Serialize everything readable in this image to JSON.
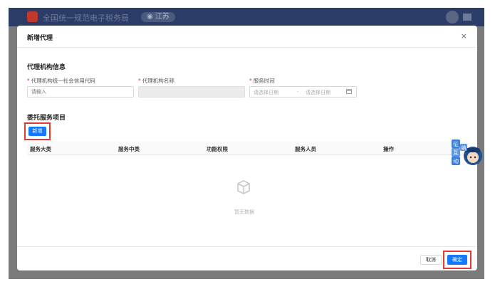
{
  "app": {
    "title": "全国统一规范电子税务局",
    "region": "江苏"
  },
  "modal": {
    "title": "新增代理",
    "close_glyph": "×",
    "agency_section_title": "代理机构信息",
    "fields": {
      "credit_code": {
        "label": "代理机构统一社会信用代码",
        "placeholder": "请输入",
        "value": ""
      },
      "agency_name": {
        "label": "代理机构名称",
        "value": ""
      },
      "service_time": {
        "label": "服务时间",
        "start_placeholder": "请选择日期",
        "separator": "-",
        "end_placeholder": "请选择日期"
      }
    },
    "service_section_title": "委托服务项目",
    "add_label": "新增",
    "table": {
      "columns": [
        "服务大类",
        "服务中类",
        "功能权限",
        "服务人员",
        "操作"
      ],
      "rows": [],
      "empty_text": "暂无数据"
    },
    "cancel_label": "取消",
    "ok_label": "确定"
  },
  "mascot": {
    "chars": [
      "征",
      "纳",
      "互",
      "动"
    ]
  },
  "colors": {
    "primary": "#1677ff",
    "highlight": "#e53935",
    "header_bg": "#2b3c66"
  },
  "icons": {
    "logo": "tax-emblem-icon",
    "close": "close-icon",
    "calendar": "calendar-icon",
    "empty": "empty-box-icon",
    "avatar": "avatar-icon",
    "menu": "menu-icon"
  }
}
